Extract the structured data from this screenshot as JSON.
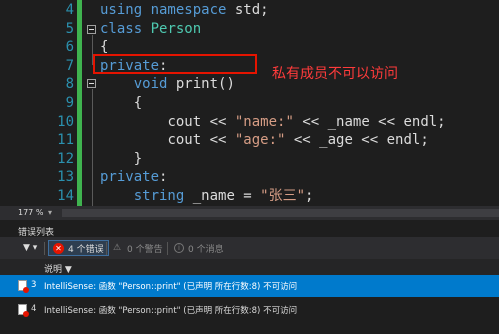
{
  "editor": {
    "line_numbers": [
      "4",
      "5",
      "6",
      "7",
      "8",
      "9",
      "10",
      "11",
      "12",
      "13",
      "14"
    ],
    "lines": [
      {
        "indent": "",
        "parts": [
          {
            "t": "kw",
            "v": "using namespace"
          },
          {
            "t": "plain",
            "v": " std;"
          }
        ]
      },
      {
        "indent": "",
        "parts": [
          {
            "t": "kw",
            "v": "class"
          },
          {
            "t": "plain",
            "v": " "
          },
          {
            "t": "ty",
            "v": "Person"
          }
        ]
      },
      {
        "indent": "",
        "parts": [
          {
            "t": "plain",
            "v": "{"
          }
        ]
      },
      {
        "indent": "",
        "parts": [
          {
            "t": "kw",
            "v": "private"
          },
          {
            "t": "plain",
            "v": ":"
          }
        ]
      },
      {
        "indent": "    ",
        "parts": [
          {
            "t": "kw",
            "v": "void"
          },
          {
            "t": "plain",
            "v": " print()"
          }
        ]
      },
      {
        "indent": "    ",
        "parts": [
          {
            "t": "plain",
            "v": "{"
          }
        ]
      },
      {
        "indent": "        ",
        "parts": [
          {
            "t": "plain",
            "v": "cout << "
          },
          {
            "t": "str",
            "v": "\"name:\""
          },
          {
            "t": "plain",
            "v": " << _name << endl;"
          }
        ]
      },
      {
        "indent": "        ",
        "parts": [
          {
            "t": "plain",
            "v": "cout << "
          },
          {
            "t": "str",
            "v": "\"age:\""
          },
          {
            "t": "plain",
            "v": " << _age << endl;"
          }
        ]
      },
      {
        "indent": "    ",
        "parts": [
          {
            "t": "plain",
            "v": "}"
          }
        ]
      },
      {
        "indent": "",
        "parts": [
          {
            "t": "kw",
            "v": "private"
          },
          {
            "t": "plain",
            "v": ":"
          }
        ]
      },
      {
        "indent": "    ",
        "parts": [
          {
            "t": "kw",
            "v": "string"
          },
          {
            "t": "plain",
            "v": " _name = "
          },
          {
            "t": "str",
            "v": "\"张三\""
          },
          {
            "t": "plain",
            "v": ";"
          }
        ]
      }
    ],
    "annotation": "私有成员不可以访问"
  },
  "status": {
    "zoom": "177 %",
    "zoom_caret": "▾"
  },
  "error_list": {
    "title": "错误列表",
    "filter_icon": "filter-icon",
    "errors_label": "4 个错误",
    "warnings_label": "0 个警告",
    "messages_label": "0 个消息",
    "column_description": "说明",
    "rows": [
      {
        "num": "3",
        "text": "IntelliSense:  函数 \"Person::print\" (已声明 所在行数:8) 不可访问",
        "selected": true
      },
      {
        "num": "4",
        "text": "IntelliSense:  函数 \"Person::print\" (已声明 所在行数:8) 不可访问",
        "selected": false
      }
    ]
  },
  "colors": {
    "keyword": "#569cd6",
    "type": "#4ec9b0",
    "string": "#d69d85",
    "accent": "#007acc",
    "error": "#e51400",
    "gutter_bar": "#3fb34f"
  }
}
